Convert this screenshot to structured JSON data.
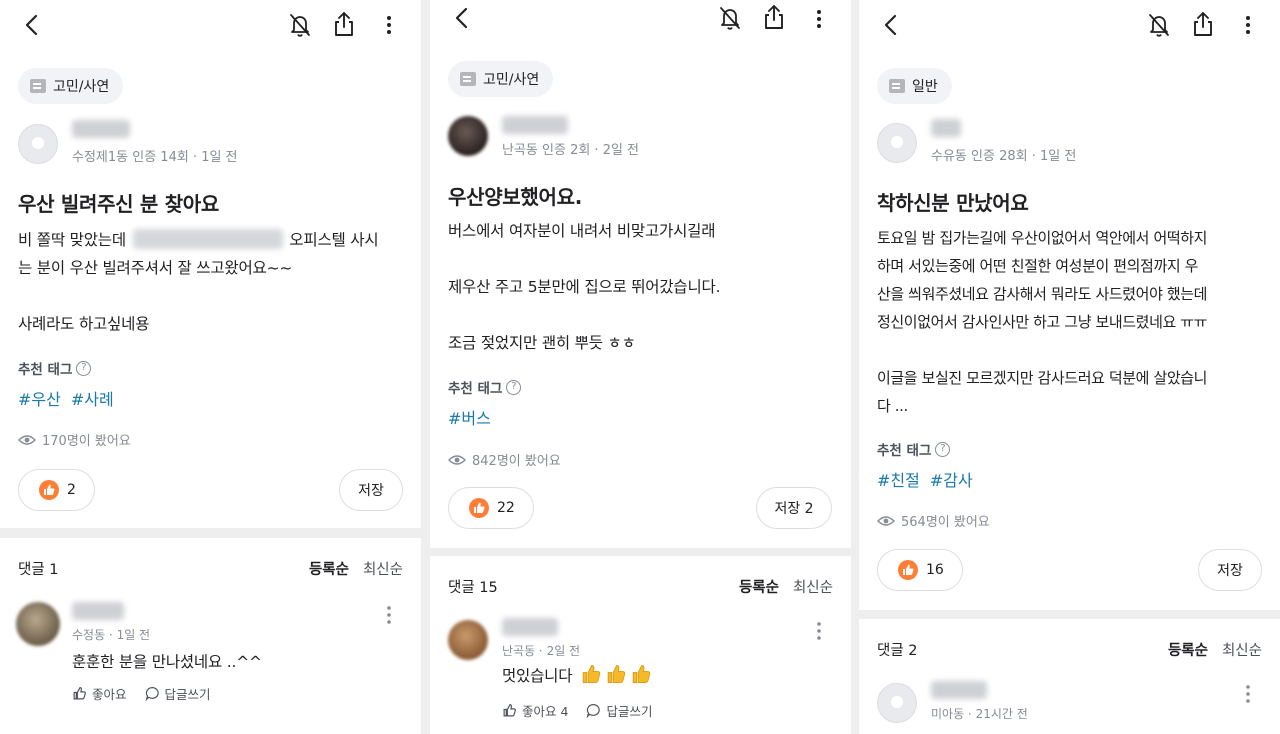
{
  "colors": {
    "accent": "#ff7e36",
    "tag": "#1a7aaa",
    "muted": "#868b94"
  },
  "posts": [
    {
      "category": "고민/사연",
      "author_meta": "수정제1동 인증 14회 · 1일 전",
      "title": "우산 빌려주신 분 찾아요",
      "body_line1_a": "비 쫄딱 맞았는데",
      "body_line1_b": "오피스텔 사시",
      "body_rest": "는 분이 우산 빌려주셔서 잘 쓰고왔어요~~\n\n사례라도 하고싶네용",
      "tag_label": "추천 태그",
      "tags": [
        "#우산",
        "#사례"
      ],
      "views": "170명이 봤어요",
      "likes": "2",
      "save_label": "저장",
      "comments_header": "댓글 1",
      "sort_primary": "등록순",
      "sort_secondary": "최신순",
      "comment": {
        "meta": "수정동 · 1일 전",
        "text": "훈훈한 분을 만나셨네요 ..^^",
        "like_label": "좋아요",
        "reply_label": "답글쓰기"
      }
    },
    {
      "category": "고민/사연",
      "author_meta": "난곡동 인증 2회 · 2일 전",
      "title": "우산양보했어요.",
      "body": "버스에서 여자분이 내려서 비맞고가시길래\n\n제우산 주고 5분만에 집으로 뛰어갔습니다.\n\n조금 젖었지만 괜히 뿌듯 ㅎㅎ",
      "tag_label": "추천 태그",
      "tags": [
        "#버스"
      ],
      "views": "842명이 봤어요",
      "likes": "22",
      "save_label": "저장 2",
      "comments_header": "댓글 15",
      "sort_primary": "등록순",
      "sort_secondary": "최신순",
      "comment": {
        "meta": "난곡동 · 2일 전",
        "text": "멋있습니다",
        "like_label": "좋아요 4",
        "reply_label": "답글쓰기"
      }
    },
    {
      "category": "일반",
      "author_meta": "수유동 인증 28회 · 1일 전",
      "title": "착하신분 만났어요",
      "body": "토요일 밤 집가는길에 우산이없어서 역안에서 어떡하지\n하며 서있는중에 어떤 친절한 여성분이 편의점까지 우\n산을 씌워주셨네요 감사해서 뭐라도 사드렸어야 했는데\n정신이없어서 감사인사만 하고 그냥 보내드렸네요 ㅠㅠ\n\n이글을 보실진 모르겠지만 감사드러요 덕분에 살았습니\n다 ...",
      "tag_label": "추천 태그",
      "tags": [
        "#친절",
        "#감사"
      ],
      "views": "564명이 봤어요",
      "likes": "16",
      "save_label": "저장",
      "comments_header": "댓글 2",
      "sort_primary": "등록순",
      "sort_secondary": "최신순",
      "comment": {
        "meta": "미아동 · 21시간 전"
      }
    }
  ]
}
